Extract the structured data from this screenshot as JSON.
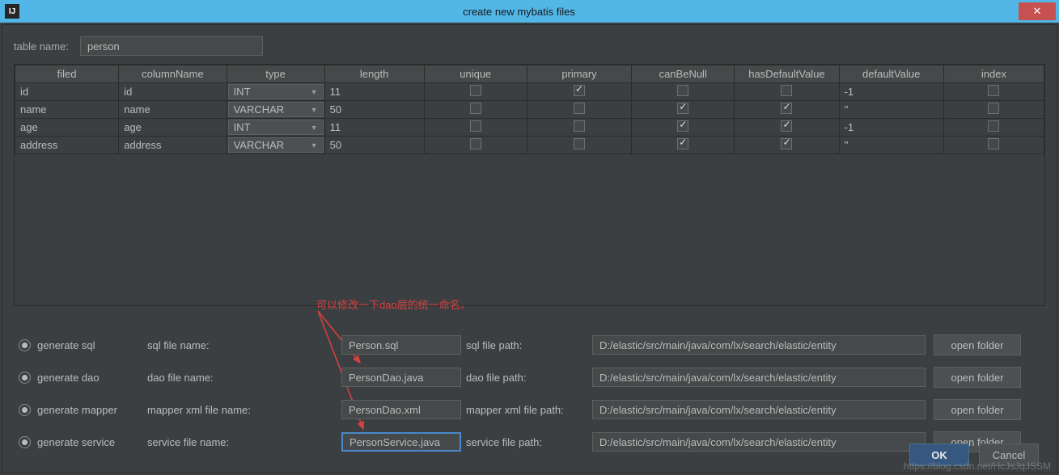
{
  "titlebar": {
    "title": "create new mybatis files",
    "icon_char": "IJ"
  },
  "tablename": {
    "label": "table name:",
    "value": "person"
  },
  "columns": [
    "filed",
    "columnName",
    "type",
    "length",
    "unique",
    "primary",
    "canBeNull",
    "hasDefaultValue",
    "defaultValue",
    "index"
  ],
  "rows": [
    {
      "filed": "id",
      "columnName": "id",
      "type": "INT",
      "length": "11",
      "unique": false,
      "primary": true,
      "canBeNull": false,
      "hasDefaultValue": false,
      "defaultValue": "-1",
      "index": false
    },
    {
      "filed": "name",
      "columnName": "name",
      "type": "VARCHAR",
      "length": "50",
      "unique": false,
      "primary": false,
      "canBeNull": true,
      "hasDefaultValue": true,
      "defaultValue": "''",
      "index": false
    },
    {
      "filed": "age",
      "columnName": "age",
      "type": "INT",
      "length": "11",
      "unique": false,
      "primary": false,
      "canBeNull": true,
      "hasDefaultValue": true,
      "defaultValue": "-1",
      "index": false
    },
    {
      "filed": "address",
      "columnName": "address",
      "type": "VARCHAR",
      "length": "50",
      "unique": false,
      "primary": false,
      "canBeNull": true,
      "hasDefaultValue": true,
      "defaultValue": "''",
      "index": false
    }
  ],
  "annotation": "可以修改一下dao层的统一命名。",
  "gen": [
    {
      "radio": "generate sql",
      "lbl2": "sql file name:",
      "in1": "Person.sql",
      "lbl3": "sql file path:",
      "in2": "D:/elastic/src/main/java/com/lx/search/elastic/entity",
      "btn": "open folder",
      "focus": false
    },
    {
      "radio": "generate dao",
      "lbl2": "dao file name:",
      "in1": "PersonDao.java",
      "lbl3": "dao file path:",
      "in2": "D:/elastic/src/main/java/com/lx/search/elastic/entity",
      "btn": "open folder",
      "focus": false
    },
    {
      "radio": "generate mapper",
      "lbl2": "mapper xml file name:",
      "in1": "PersonDao.xml",
      "lbl3": "mapper xml file path:",
      "in2": "D:/elastic/src/main/java/com/lx/search/elastic/entity",
      "btn": "open folder",
      "focus": false
    },
    {
      "radio": "generate service",
      "lbl2": "service file name:",
      "in1": "PersonService.java",
      "lbl3": "service file path:",
      "in2": "D:/elastic/src/main/java/com/lx/search/elastic/entity",
      "btn": "open folder",
      "focus": true
    }
  ],
  "footer": {
    "ok": "OK",
    "cancel": "Cancel"
  },
  "watermark": "https://blog.csdn.net/HcJsJqJSSM"
}
